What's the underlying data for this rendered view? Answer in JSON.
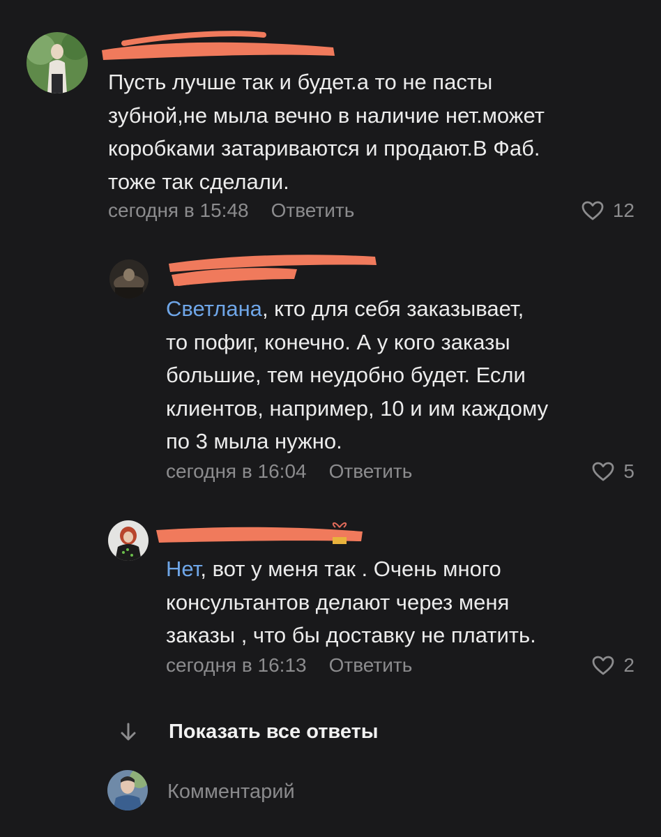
{
  "comments": [
    {
      "mention": "",
      "text": "Пусть лучше так и будет.а то не пасты\nзубной,не мыла вечно в наличие нет.может\nкоробками затариваются и продают.В Фаб.\nтоже так сделали.",
      "time": "сегодня в 15:48",
      "reply_label": "Ответить",
      "likes": "12"
    },
    {
      "mention": "Светлана",
      "text": ", кто для себя заказывает,\nто пофиг, конечно. А у кого заказы\nбольшие, тем неудобно будет. Если\nклиентов, например, 10 и им каждому\nпо 3 мыла нужно.",
      "time": "сегодня в 16:04",
      "reply_label": "Ответить",
      "likes": "5"
    },
    {
      "mention": "Нет",
      "text": ", вот у меня так . Очень много\nконсультантов делают через меня\nзаказы , что бы доставку не платить.",
      "time": "сегодня в 16:13",
      "reply_label": "Ответить",
      "likes": "2"
    }
  ],
  "show_all_replies": "Показать все ответы",
  "composer": {
    "placeholder": "Комментарий"
  },
  "colors": {
    "background": "#19191b",
    "mention": "#6fa6e8",
    "redaction": "#f07a5c",
    "muted": "#8c8c8e"
  }
}
